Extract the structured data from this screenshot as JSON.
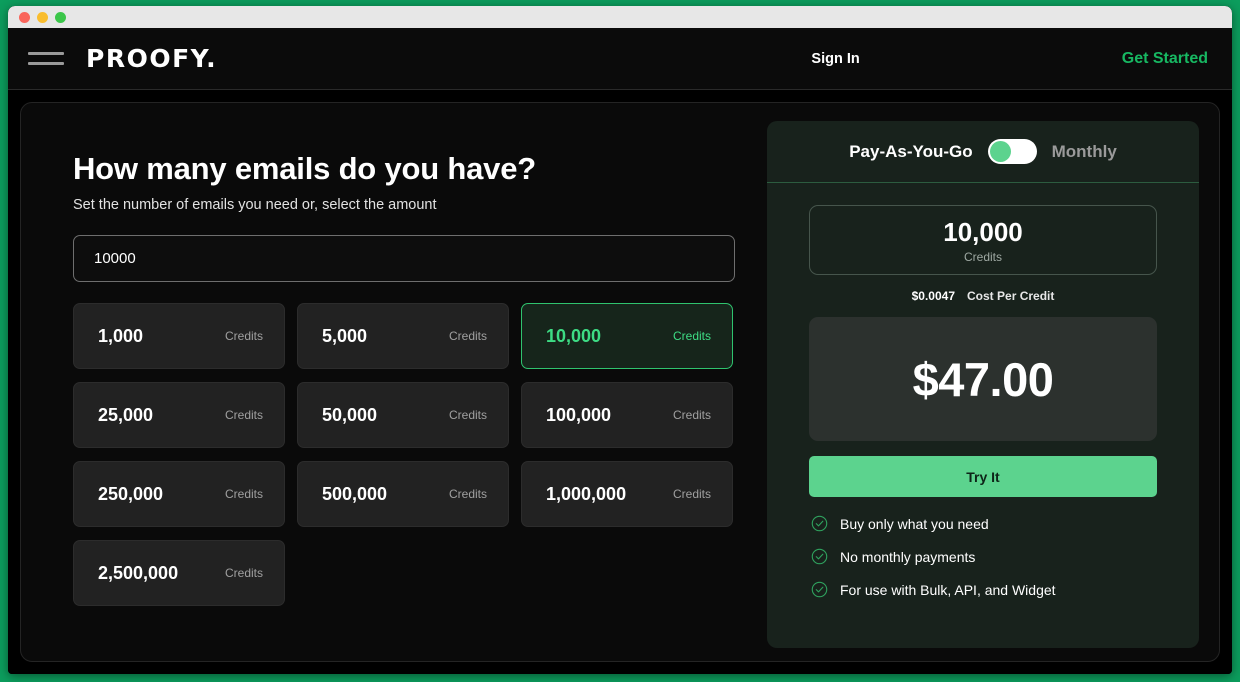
{
  "window": {
    "traffic_lights": [
      "close",
      "minimize",
      "maximize"
    ]
  },
  "header": {
    "menu_icon": "hamburger-icon",
    "brand": "PROOFY.",
    "sign_in_label": "Sign In",
    "get_started_label": "Get Started",
    "accent_color": "#17b862"
  },
  "left": {
    "headline": "How many emails do you have?",
    "subline": "Set the number of emails you need or, select the amount",
    "input": {
      "value": "10000",
      "placeholder": "10000"
    },
    "credits_label": "Credits",
    "options": [
      {
        "value": "1,000",
        "label": "Credits",
        "selected": false
      },
      {
        "value": "5,000",
        "label": "Credits",
        "selected": false
      },
      {
        "value": "10,000",
        "label": "Credits",
        "selected": true
      },
      {
        "value": "25,000",
        "label": "Credits",
        "selected": false
      },
      {
        "value": "50,000",
        "label": "Credits",
        "selected": false
      },
      {
        "value": "100,000",
        "label": "Credits",
        "selected": false
      },
      {
        "value": "250,000",
        "label": "Credits",
        "selected": false
      },
      {
        "value": "500,000",
        "label": "Credits",
        "selected": false
      },
      {
        "value": "1,000,000",
        "label": "Credits",
        "selected": false
      },
      {
        "value": "2,500,000",
        "label": "Credits",
        "selected": false
      }
    ]
  },
  "right": {
    "toggle": {
      "left_label": "Pay-As-You-Go",
      "right_label": "Monthly",
      "state": "left",
      "knob_color": "#5cd38e"
    },
    "credits": {
      "amount": "10,000",
      "caption": "Credits"
    },
    "cost_per_credit": {
      "price": "$0.0047",
      "caption": "Cost Per Credit"
    },
    "total_price": "$47.00",
    "cta_label": "Try It",
    "cta_color": "#5cd38e",
    "features": [
      {
        "icon": "check-circle-icon",
        "text": "Buy only what you need"
      },
      {
        "icon": "check-circle-icon",
        "text": "No monthly payments"
      },
      {
        "icon": "check-circle-icon",
        "text": "For use with Bulk, API, and Widget"
      }
    ]
  },
  "colors": {
    "page_background": "#0c9d5d",
    "app_background": "#000000",
    "panel_background": "#18221c",
    "selected_card_background": "#16251b",
    "selected_card_border": "#2fc36e",
    "accent_green": "#3ddc84"
  }
}
